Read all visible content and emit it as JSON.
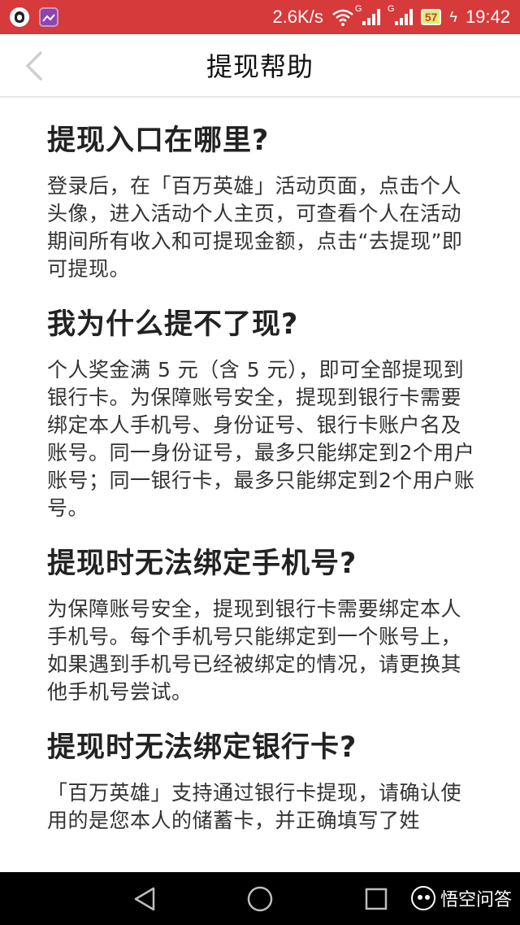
{
  "status_bar": {
    "network_speed": "2.6K/s",
    "signal_1_label": "G",
    "signal_2_label": "G",
    "battery": "57",
    "time": "19:42",
    "icons": [
      "qq-penguin-icon",
      "gallery-icon",
      "wifi-icon",
      "signal-icon",
      "signal-icon",
      "battery-icon",
      "charging-icon"
    ]
  },
  "header": {
    "title": "提现帮助",
    "back_icon": "chevron-left-icon"
  },
  "faqs": [
    {
      "question": "提现入口在哪里?",
      "answer": "登录后，在「百万英雄」活动页面，点击个人头像，进入活动个人主页，可查看个人在活动期间所有收入和可提现金额，点击“去提现”即可提现。"
    },
    {
      "question": "我为什么提不了现?",
      "answer": "个人奖金满 5 元（含 5 元），即可全部提现到银行卡。为保障账号安全，提现到银行卡需要绑定本人手机号、身份证号、银行卡账户名及账号。同一身份证号，最多只能绑定到2个用户账号；同一银行卡，最多只能绑定到2个用户账号。"
    },
    {
      "question": "提现时无法绑定手机号?",
      "answer": "为保障账号安全，提现到银行卡需要绑定本人手机号。每个手机号只能绑定到一个账号上，如果遇到手机号已经被绑定的情况，请更换其他手机号尝试。"
    },
    {
      "question": "提现时无法绑定银行卡?",
      "answer": "「百万英雄」支持通过银行卡提现，请确认使用的是您本人的储蓄卡，并正确填写了姓"
    }
  ],
  "nav_bar": {
    "buttons": [
      "nav-back-icon",
      "nav-home-icon",
      "nav-recent-icon"
    ],
    "watermark_text": "悟空问答"
  },
  "colors": {
    "status_bar": "#d63a3a",
    "heading": "#222222",
    "body_text": "#333333",
    "nav_bar": "#000000"
  }
}
